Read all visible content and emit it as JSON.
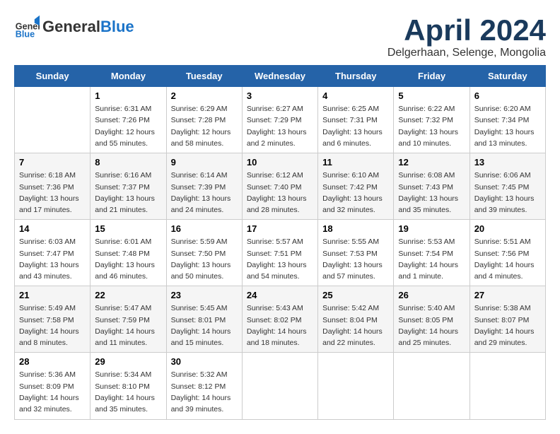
{
  "logo": {
    "general": "General",
    "blue": "Blue"
  },
  "title": "April 2024",
  "subtitle": "Delgerhaan, Selenge, Mongolia",
  "weekdays": [
    "Sunday",
    "Monday",
    "Tuesday",
    "Wednesday",
    "Thursday",
    "Friday",
    "Saturday"
  ],
  "weeks": [
    [
      {
        "date": "",
        "detail": ""
      },
      {
        "date": "1",
        "detail": "Sunrise: 6:31 AM\nSunset: 7:26 PM\nDaylight: 12 hours\nand 55 minutes."
      },
      {
        "date": "2",
        "detail": "Sunrise: 6:29 AM\nSunset: 7:28 PM\nDaylight: 12 hours\nand 58 minutes."
      },
      {
        "date": "3",
        "detail": "Sunrise: 6:27 AM\nSunset: 7:29 PM\nDaylight: 13 hours\nand 2 minutes."
      },
      {
        "date": "4",
        "detail": "Sunrise: 6:25 AM\nSunset: 7:31 PM\nDaylight: 13 hours\nand 6 minutes."
      },
      {
        "date": "5",
        "detail": "Sunrise: 6:22 AM\nSunset: 7:32 PM\nDaylight: 13 hours\nand 10 minutes."
      },
      {
        "date": "6",
        "detail": "Sunrise: 6:20 AM\nSunset: 7:34 PM\nDaylight: 13 hours\nand 13 minutes."
      }
    ],
    [
      {
        "date": "7",
        "detail": "Sunrise: 6:18 AM\nSunset: 7:36 PM\nDaylight: 13 hours\nand 17 minutes."
      },
      {
        "date": "8",
        "detail": "Sunrise: 6:16 AM\nSunset: 7:37 PM\nDaylight: 13 hours\nand 21 minutes."
      },
      {
        "date": "9",
        "detail": "Sunrise: 6:14 AM\nSunset: 7:39 PM\nDaylight: 13 hours\nand 24 minutes."
      },
      {
        "date": "10",
        "detail": "Sunrise: 6:12 AM\nSunset: 7:40 PM\nDaylight: 13 hours\nand 28 minutes."
      },
      {
        "date": "11",
        "detail": "Sunrise: 6:10 AM\nSunset: 7:42 PM\nDaylight: 13 hours\nand 32 minutes."
      },
      {
        "date": "12",
        "detail": "Sunrise: 6:08 AM\nSunset: 7:43 PM\nDaylight: 13 hours\nand 35 minutes."
      },
      {
        "date": "13",
        "detail": "Sunrise: 6:06 AM\nSunset: 7:45 PM\nDaylight: 13 hours\nand 39 minutes."
      }
    ],
    [
      {
        "date": "14",
        "detail": "Sunrise: 6:03 AM\nSunset: 7:47 PM\nDaylight: 13 hours\nand 43 minutes."
      },
      {
        "date": "15",
        "detail": "Sunrise: 6:01 AM\nSunset: 7:48 PM\nDaylight: 13 hours\nand 46 minutes."
      },
      {
        "date": "16",
        "detail": "Sunrise: 5:59 AM\nSunset: 7:50 PM\nDaylight: 13 hours\nand 50 minutes."
      },
      {
        "date": "17",
        "detail": "Sunrise: 5:57 AM\nSunset: 7:51 PM\nDaylight: 13 hours\nand 54 minutes."
      },
      {
        "date": "18",
        "detail": "Sunrise: 5:55 AM\nSunset: 7:53 PM\nDaylight: 13 hours\nand 57 minutes."
      },
      {
        "date": "19",
        "detail": "Sunrise: 5:53 AM\nSunset: 7:54 PM\nDaylight: 14 hours\nand 1 minute."
      },
      {
        "date": "20",
        "detail": "Sunrise: 5:51 AM\nSunset: 7:56 PM\nDaylight: 14 hours\nand 4 minutes."
      }
    ],
    [
      {
        "date": "21",
        "detail": "Sunrise: 5:49 AM\nSunset: 7:58 PM\nDaylight: 14 hours\nand 8 minutes."
      },
      {
        "date": "22",
        "detail": "Sunrise: 5:47 AM\nSunset: 7:59 PM\nDaylight: 14 hours\nand 11 minutes."
      },
      {
        "date": "23",
        "detail": "Sunrise: 5:45 AM\nSunset: 8:01 PM\nDaylight: 14 hours\nand 15 minutes."
      },
      {
        "date": "24",
        "detail": "Sunrise: 5:43 AM\nSunset: 8:02 PM\nDaylight: 14 hours\nand 18 minutes."
      },
      {
        "date": "25",
        "detail": "Sunrise: 5:42 AM\nSunset: 8:04 PM\nDaylight: 14 hours\nand 22 minutes."
      },
      {
        "date": "26",
        "detail": "Sunrise: 5:40 AM\nSunset: 8:05 PM\nDaylight: 14 hours\nand 25 minutes."
      },
      {
        "date": "27",
        "detail": "Sunrise: 5:38 AM\nSunset: 8:07 PM\nDaylight: 14 hours\nand 29 minutes."
      }
    ],
    [
      {
        "date": "28",
        "detail": "Sunrise: 5:36 AM\nSunset: 8:09 PM\nDaylight: 14 hours\nand 32 minutes."
      },
      {
        "date": "29",
        "detail": "Sunrise: 5:34 AM\nSunset: 8:10 PM\nDaylight: 14 hours\nand 35 minutes."
      },
      {
        "date": "30",
        "detail": "Sunrise: 5:32 AM\nSunset: 8:12 PM\nDaylight: 14 hours\nand 39 minutes."
      },
      {
        "date": "",
        "detail": ""
      },
      {
        "date": "",
        "detail": ""
      },
      {
        "date": "",
        "detail": ""
      },
      {
        "date": "",
        "detail": ""
      }
    ]
  ]
}
